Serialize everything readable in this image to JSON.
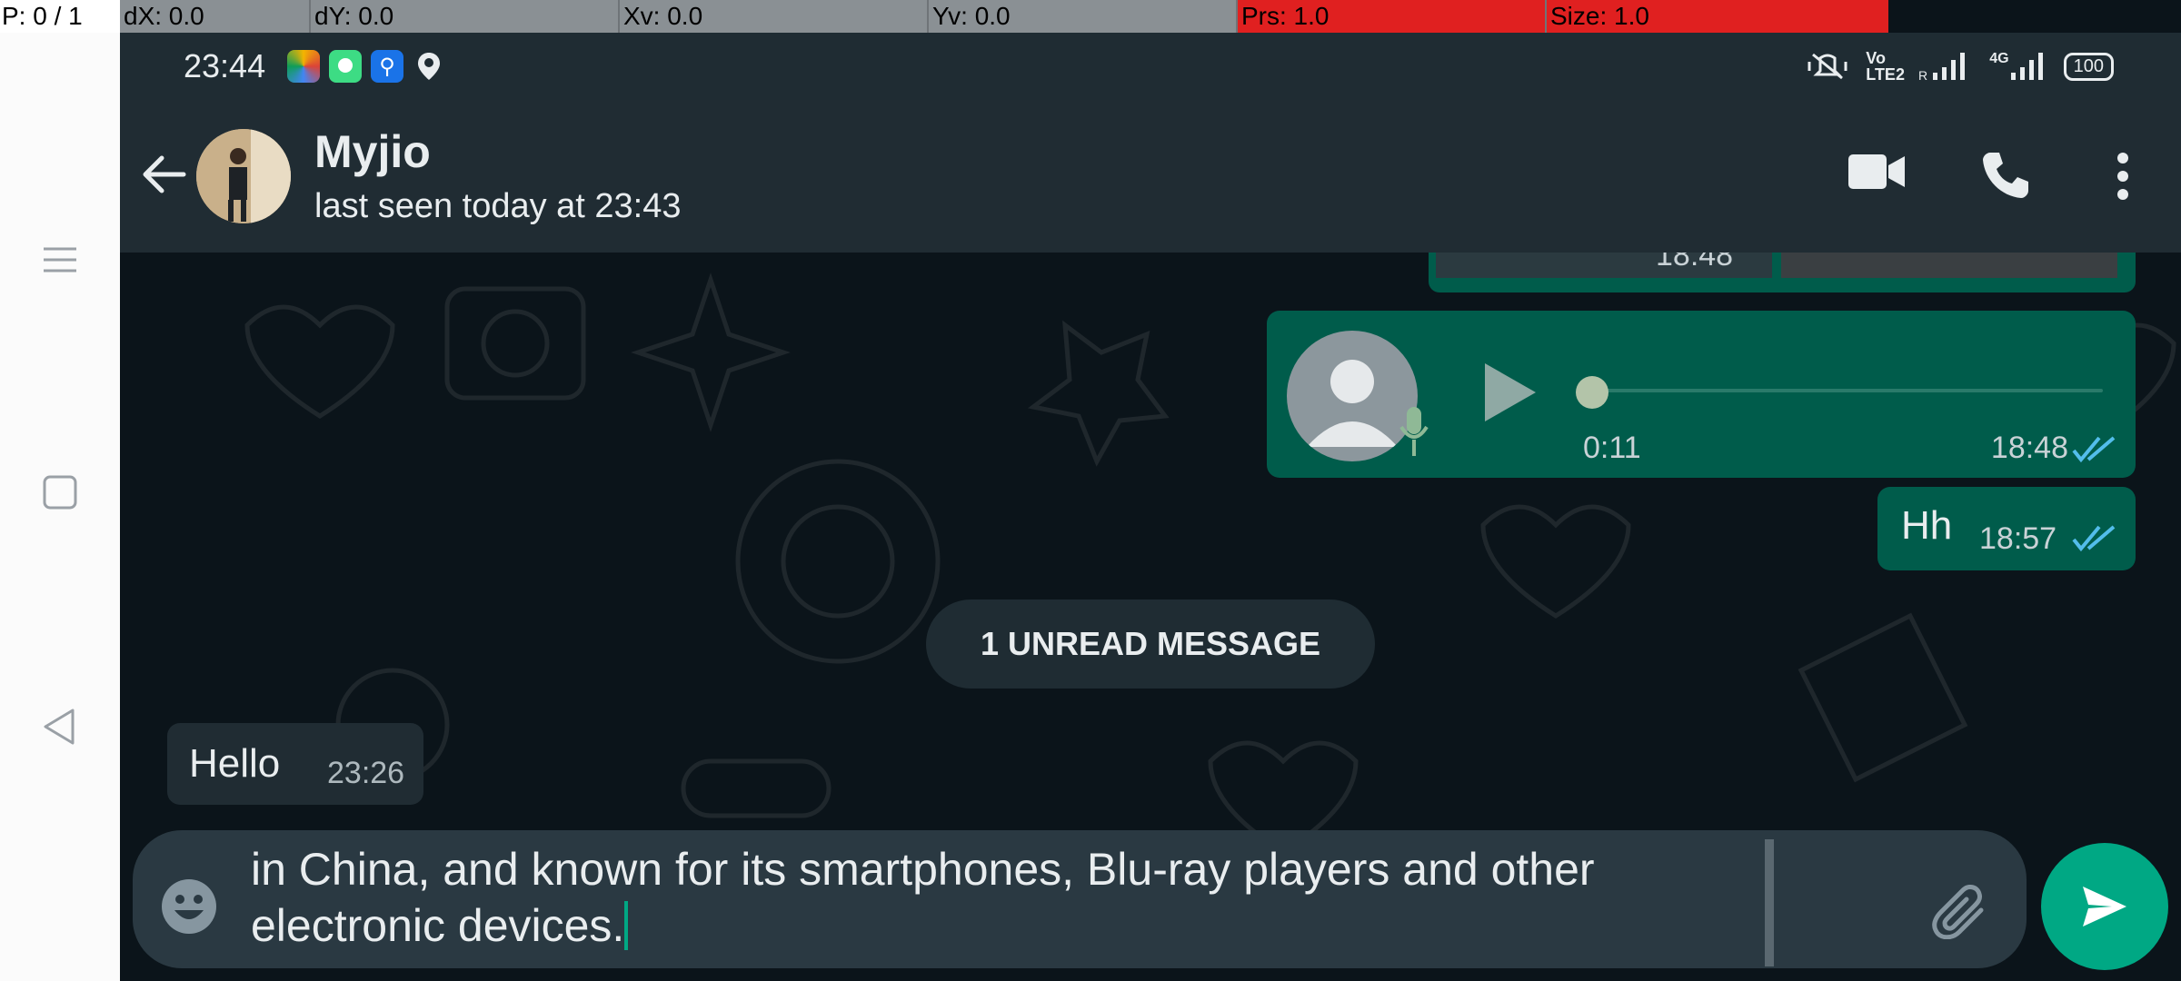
{
  "debug_bar": {
    "pointer": "P: 0 / 1",
    "dx": "dX: 0.0",
    "dy": "dY: 0.0",
    "xv": "Xv: 0.0",
    "yv": "Yv: 0.0",
    "prs": "Prs: 1.0",
    "size": "Size: 1.0"
  },
  "status_bar": {
    "time": "23:44",
    "app_icons": [
      "photos-icon",
      "message-icon",
      "usb-icon",
      "location-icon"
    ],
    "volte_label": "Vo LTE2",
    "network_label": "4G",
    "battery": "100"
  },
  "header": {
    "name": "Myjio",
    "status": "last seen today at 23:43",
    "icons": [
      "video-call-icon",
      "phone-icon",
      "more-options-icon"
    ]
  },
  "messages": {
    "media_time": "18:48",
    "voice": {
      "duration": "0:11",
      "time": "18:48"
    },
    "hh": {
      "text": "Hh",
      "time": "18:57"
    },
    "unread_label": "1 UNREAD MESSAGE",
    "hello": {
      "text": "Hello",
      "time": "23:26"
    }
  },
  "composer": {
    "text_line1": "in China, and known for its smartphones, Blu-ray players and other",
    "text_line2": "electronic devices."
  },
  "colors": {
    "outgoing_bubble": "#005c4b",
    "incoming_bubble": "#202c33",
    "accent": "#00a884",
    "read_ticks": "#53bdeb"
  }
}
